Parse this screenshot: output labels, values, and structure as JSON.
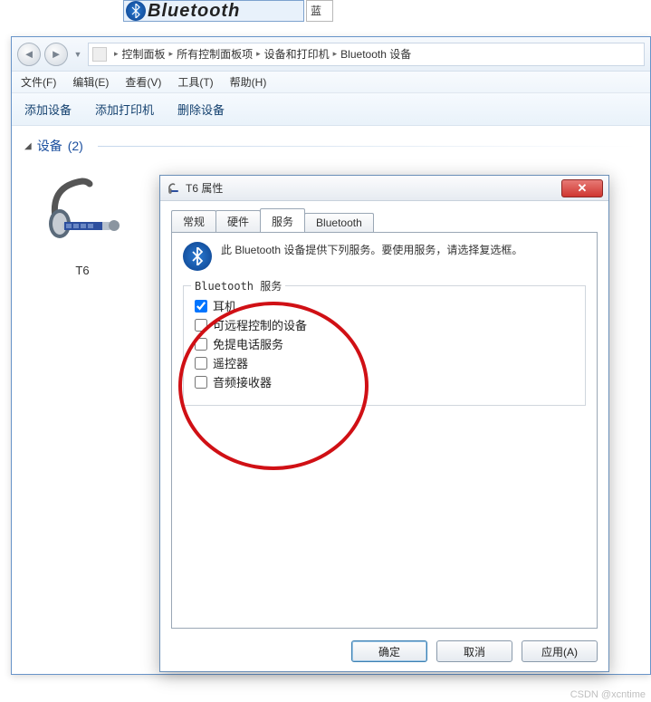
{
  "remnant": {
    "text": "Bluetooth",
    "remnant_char": "蓝"
  },
  "explorer": {
    "breadcrumbs": [
      "控制面板",
      "所有控制面板项",
      "设备和打印机",
      "Bluetooth 设备"
    ],
    "menus": {
      "file": "文件(F)",
      "edit": "编辑(E)",
      "view": "查看(V)",
      "tools": "工具(T)",
      "help": "帮助(H)"
    },
    "toolbar": {
      "add_device": "添加设备",
      "add_printer": "添加打印机",
      "delete_device": "删除设备"
    },
    "group": {
      "label": "设备",
      "count": "(2)"
    },
    "device": {
      "name": "T6"
    }
  },
  "dialog": {
    "title": "T6 属性",
    "tabs": {
      "general": "常规",
      "hardware": "硬件",
      "services": "服务",
      "bluetooth": "Bluetooth"
    },
    "description": "此 Bluetooth 设备提供下列服务。要使用服务，请选择复选框。",
    "fieldset_legend": "Bluetooth 服务",
    "services": [
      {
        "label": "耳机",
        "checked": true
      },
      {
        "label": "可远程控制的设备",
        "checked": false
      },
      {
        "label": "免提电话服务",
        "checked": false
      },
      {
        "label": "遥控器",
        "checked": false
      },
      {
        "label": "音频接收器",
        "checked": false
      }
    ],
    "buttons": {
      "ok": "确定",
      "cancel": "取消",
      "apply": "应用(A)"
    }
  },
  "watermark": "CSDN @xcntime"
}
